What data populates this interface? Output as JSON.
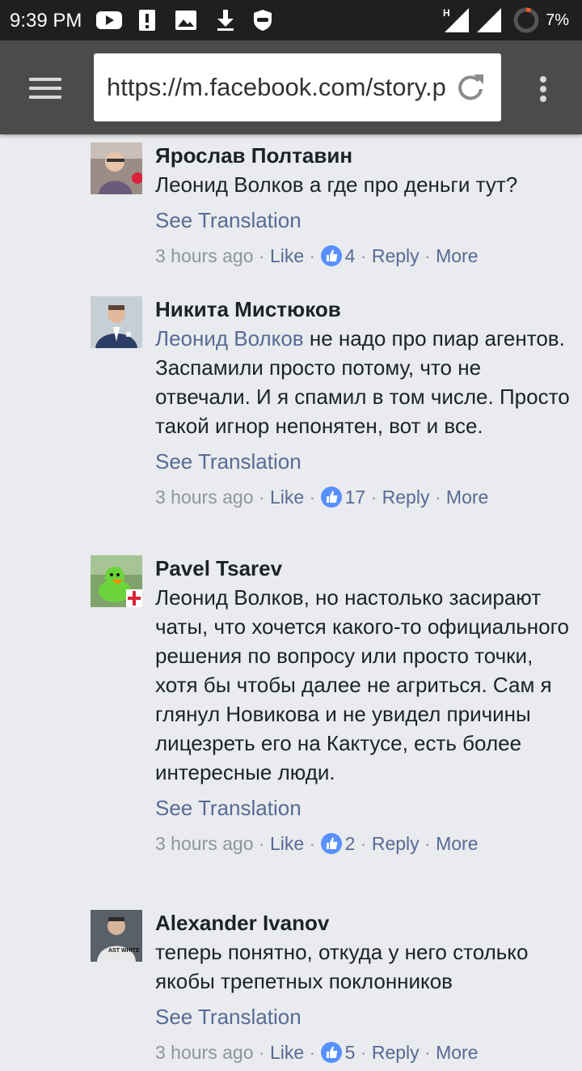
{
  "status_bar": {
    "time": "9:39 PM",
    "battery": "7%",
    "network": "H"
  },
  "browser": {
    "url": "https://m.facebook.com/story.php"
  },
  "comments": [
    {
      "author": "Ярослав Полтавин",
      "mention": "",
      "text": "Леонид Волков а где про деньги тут?",
      "see_translation": "See Translation",
      "time": "3 hours ago",
      "like": "Like",
      "likes": "4",
      "reply": "Reply",
      "more": "More"
    },
    {
      "author": "Никита Мистюков",
      "mention": "Леонид Волков",
      "text": " не надо про пиар агентов. Заспамили просто потому, что не отвечали. И я спамил в том числе. Просто такой игнор непонятен, вот и все.",
      "see_translation": "See Translation",
      "time": "3 hours ago",
      "like": "Like",
      "likes": "17",
      "reply": "Reply",
      "more": "More"
    },
    {
      "author": "Pavel Tsarev",
      "mention": "",
      "text": "Леонид Волков, но настолько засирают чаты, что хочется какого-то официального решения по вопросу или просто точки, хотя бы чтобы далее не агриться. Сам я глянул Новикова и не увидел причины лицезреть его на Кактусе, есть более интересные люди.",
      "see_translation": "See Translation",
      "time": "3 hours ago",
      "like": "Like",
      "likes": "2",
      "reply": "Reply",
      "more": "More"
    },
    {
      "author": "Alexander Ivanov",
      "mention": "",
      "text": "теперь понятно, откуда у него столько якобы трепетных поклонников",
      "see_translation": "See Translation",
      "time": "3 hours ago",
      "like": "Like",
      "likes": "5",
      "reply": "Reply",
      "more": "More"
    }
  ],
  "avatar_shirt_text": "AST WHITE",
  "colors": {
    "link": "#576b95",
    "meta": "#90949c",
    "like_badge": "#5890ff",
    "background": "#e9ebee",
    "toolbar": "#4b4b4b",
    "statusbar": "#1f1f1f"
  }
}
